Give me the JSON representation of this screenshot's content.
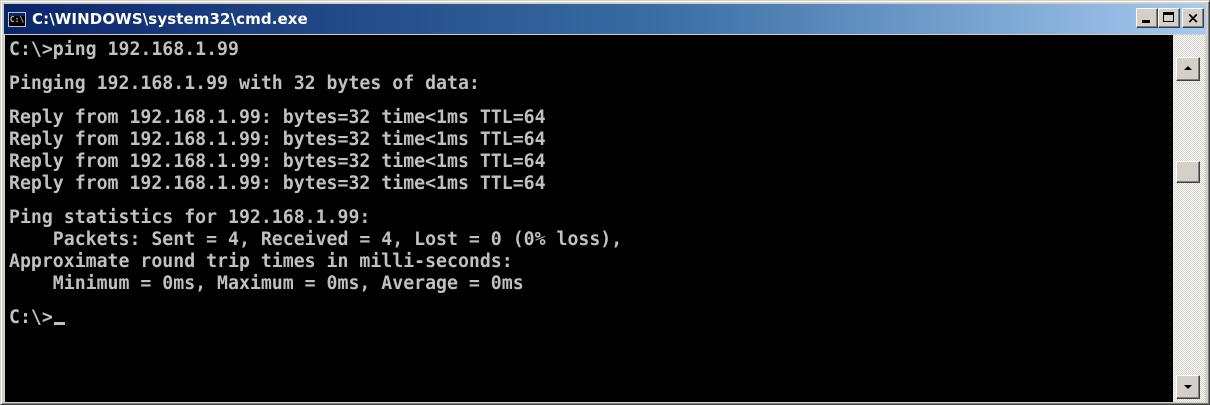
{
  "window": {
    "title": "C:\\WINDOWS\\system32\\cmd.exe",
    "icon": "console-icon",
    "icon_text": "C:\\",
    "close_glyph": "×"
  },
  "console": {
    "text_color": "#c0c0c0",
    "background": "#000000",
    "lines": [
      "C:\\>ping 192.168.1.99",
      "",
      "Pinging 192.168.1.99 with 32 bytes of data:",
      "",
      "Reply from 192.168.1.99: bytes=32 time<1ms TTL=64",
      "Reply from 192.168.1.99: bytes=32 time<1ms TTL=64",
      "Reply from 192.168.1.99: bytes=32 time<1ms TTL=64",
      "Reply from 192.168.1.99: bytes=32 time<1ms TTL=64",
      "",
      "Ping statistics for 192.168.1.99:",
      "    Packets: Sent = 4, Received = 4, Lost = 0 (0% loss),",
      "Approximate round trip times in milli-seconds:",
      "    Minimum = 0ms, Maximum = 0ms, Average = 0ms",
      "",
      "C:\\>"
    ]
  },
  "titlebar_colors": {
    "start": "#0a246a",
    "end": "#a6caf0"
  }
}
